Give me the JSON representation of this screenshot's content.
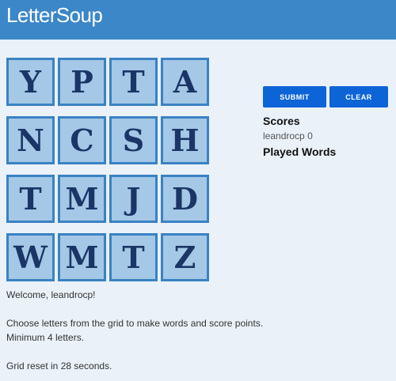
{
  "header": {
    "title": "LetterSoup"
  },
  "colors": {
    "header_bg": "#3b87c8",
    "page_bg": "#eaf1f9",
    "tile_bg": "#a4c8e6",
    "tile_border": "#3a82c3",
    "tile_text": "#1b3566",
    "button_bg": "#0d64d6"
  },
  "grid": {
    "rows": [
      [
        "Y",
        "P",
        "T",
        "A"
      ],
      [
        "N",
        "C",
        "S",
        "H"
      ],
      [
        "T",
        "M",
        "J",
        "D"
      ],
      [
        "W",
        "M",
        "T",
        "Z"
      ]
    ]
  },
  "controls": {
    "submit_label": "SUBMIT",
    "clear_label": "CLEAR"
  },
  "scores": {
    "heading": "Scores",
    "entries": [
      {
        "player": "leandrocp",
        "score": "0"
      }
    ]
  },
  "played_words": {
    "heading": "Played Words"
  },
  "messages": {
    "welcome": "Welcome, leandrocp!",
    "instructions": "Choose letters from the grid to make words and score points.",
    "minimum": "Minimum 4 letters.",
    "reset": "Grid reset in 28 seconds."
  }
}
